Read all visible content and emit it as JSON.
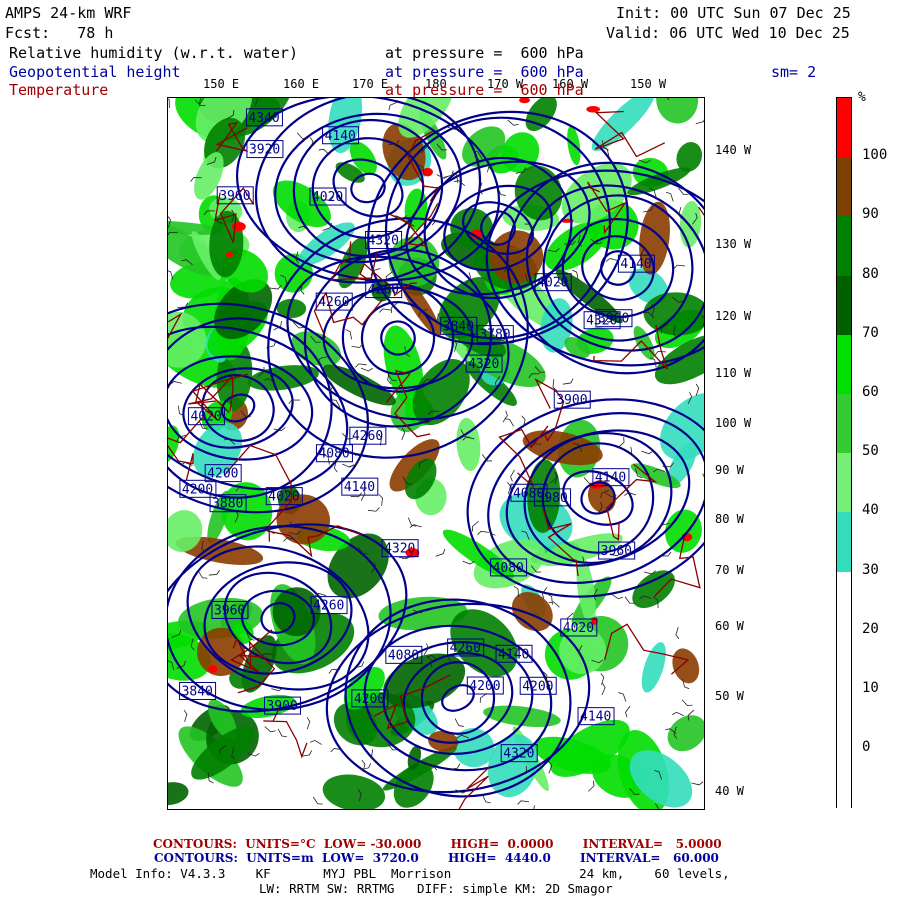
{
  "header": {
    "model": "AMPS 24-km WRF",
    "fcst": "Fcst:   78 h",
    "init": "Init: 00 UTC Sun 07 Dec 25",
    "valid": "Valid: 06 UTC Wed 10 Dec 25",
    "field1": "Relative humidity (w.r.t. water)",
    "field1_level": "at pressure =  600 hPa",
    "field2": "Geopotential height",
    "field2_level": "at pressure =  600 hPa",
    "smoothing": "sm= 2",
    "field3": "Temperature",
    "field3_level": "at pressure =  600 hPa"
  },
  "map": {
    "top_lon_labels": [
      "150 E",
      "160 E",
      "170 E",
      "180",
      "170 W",
      "160 W",
      "150 W"
    ],
    "right_lon_labels": [
      "140 W",
      "130 W",
      "120 W",
      "110 W",
      "100 W",
      "90 W",
      "80 W",
      "70 W",
      "60 W",
      "50 W",
      "40 W"
    ],
    "height_labels": [
      "4320",
      "4340",
      "4320",
      "4260",
      "4200",
      "4140",
      "4080",
      "4260",
      "4320",
      "3960",
      "4020",
      "3900",
      "4080",
      "3960",
      "4140",
      "3880",
      "4020",
      "4080",
      "4140",
      "3920",
      "3960",
      "4020",
      "3840",
      "4140",
      "3980",
      "3900",
      "3840",
      "3780",
      "4020",
      "4260",
      "4200",
      "4140",
      "4080",
      "4260",
      "4200",
      "4200",
      "4140",
      "4020",
      "4260",
      "4320",
      "4200",
      "4320",
      "3960"
    ],
    "colors": {
      "rh_shading": [
        "#ff0000",
        "#8b3c00",
        "#008000",
        "#006400",
        "#00dd00",
        "#22c422",
        "#66ee66",
        "#33ddbb"
      ],
      "height_contour": "#00008b",
      "temp_contour": "#8b0000"
    }
  },
  "colorbar": {
    "unit": "%",
    "labels": [
      "100",
      "90",
      "80",
      "70",
      "60",
      "50",
      "40",
      "30",
      "20",
      "10",
      "0"
    ],
    "colors": [
      "#ff0000",
      "#7f3f00",
      "#007f00",
      "#006000",
      "#00e000",
      "#33cc33",
      "#77ee77",
      "#33ddbb",
      "#ffffff",
      "#ffffff",
      "#ffffff",
      "#ffffff"
    ]
  },
  "footer": {
    "temp_contours": "CONTOURS:  UNITS=°C  LOW= -30.000       HIGH=  0.0000       INTERVAL=   5.0000",
    "height_contours": "CONTOURS:  UNITS=m  LOW=  3720.0       HIGH=  4440.0       INTERVAL=   60.000",
    "model_info": "Model Info: V4.3.3    KF       MYJ PBL  Morrison                 24 km,    60 levels,",
    "physics": "LW: RRTM SW: RRTMG   DIFF: simple KM: 2D Smagor"
  }
}
